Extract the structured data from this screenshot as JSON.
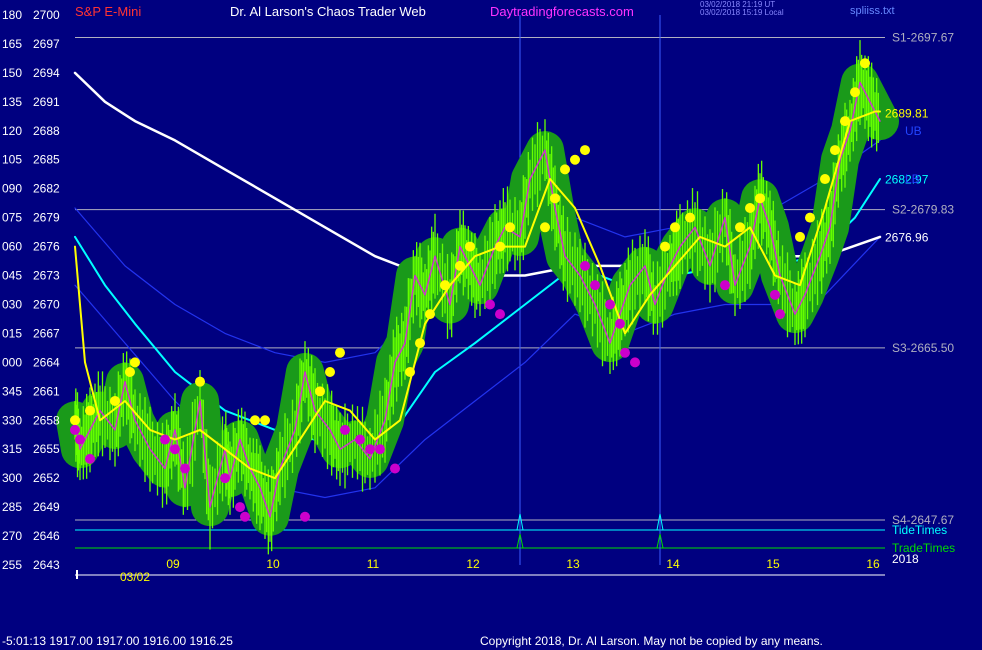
{
  "header": {
    "symbol": "S&P E-Mini",
    "title": "Dr. Al Larson's Chaos Trader Web",
    "site": "Daytradingforecasts.com",
    "timestamp_ut": "03/02/2018 21:19 UT",
    "timestamp_local": "03/02/2018 15:19 Local",
    "file": "spliiss.txt"
  },
  "footer": {
    "quote_line": "-5:01:13  1917.00 1917.00 1916.00 1916.25",
    "copyright": "Copyright 2018, Dr. Al Larson. May not be copied by any means."
  },
  "colors": {
    "background": "#000080",
    "grid": "#b0b0c0",
    "price_halo": "#1a9a1a",
    "price_bars": "#66ff00",
    "fast_avg": "#ffff00",
    "mid_avg": "#00ffff",
    "slow_avg": "#ffffff",
    "envelope": "#2233ee",
    "high_markers": "#ffff00",
    "low_markers": "#cc00cc",
    "tide_times": "#00ffff",
    "trade_times": "#00dd00"
  },
  "chart_data": {
    "type": "line",
    "y_axis": {
      "min": 2643,
      "max": 2700,
      "ticks": [
        {
          "value": 2700,
          "label": "2700",
          "left": "180"
        },
        {
          "value": 2697,
          "label": "2697",
          "left": "165"
        },
        {
          "value": 2694,
          "label": "2694",
          "left": "150"
        },
        {
          "value": 2691,
          "label": "2691",
          "left": "135"
        },
        {
          "value": 2688,
          "label": "2688",
          "left": "120"
        },
        {
          "value": 2685,
          "label": "2685",
          "left": "105"
        },
        {
          "value": 2682,
          "label": "2682",
          "left": "090"
        },
        {
          "value": 2679,
          "label": "2679",
          "left": "075"
        },
        {
          "value": 2676,
          "label": "2676",
          "left": "060"
        },
        {
          "value": 2673,
          "label": "2673",
          "left": "045"
        },
        {
          "value": 2670,
          "label": "2670",
          "left": "030"
        },
        {
          "value": 2667,
          "label": "2667",
          "left": "015"
        },
        {
          "value": 2664,
          "label": "2664",
          "left": "000"
        },
        {
          "value": 2661,
          "label": "2661",
          "left": "345"
        },
        {
          "value": 2658,
          "label": "2658",
          "left": "330"
        },
        {
          "value": 2655,
          "label": "2655",
          "left": "315"
        },
        {
          "value": 2652,
          "label": "2652",
          "left": "300"
        },
        {
          "value": 2649,
          "label": "2649",
          "left": "285"
        },
        {
          "value": 2646,
          "label": "2646",
          "left": "270"
        },
        {
          "value": 2643,
          "label": "2643",
          "left": "255"
        }
      ]
    },
    "x_axis": {
      "min": 8.0,
      "max": 16.1,
      "ticks": [
        "09",
        "10",
        "11",
        "12",
        "13",
        "14",
        "15",
        "16"
      ],
      "date_label": "03/02",
      "year_label": "2018"
    },
    "levels": [
      {
        "name": "S1",
        "value": 2697.67,
        "label": "S1-2697.67"
      },
      {
        "name": "S2",
        "value": 2679.83,
        "label": "S2-2679.83"
      },
      {
        "name": "S3",
        "value": 2665.5,
        "label": "S3-2665.50"
      },
      {
        "name": "S4",
        "value": 2647.67,
        "label": "S4-2647.67"
      }
    ],
    "band_labels": [
      "UB",
      "LB"
    ],
    "end_values": [
      {
        "value": 2689.81,
        "label": "2689.81",
        "series": "fast_avg"
      },
      {
        "value": 2682.97,
        "label": "2682.97",
        "series": "mid_avg"
      },
      {
        "value": 2676.96,
        "label": "2676.96",
        "series": "slow_avg"
      }
    ],
    "timing_lines": {
      "tide_label": "TideTimes",
      "trade_label": "TradeTimes",
      "spike_times": [
        12.45,
        13.85
      ]
    },
    "price": {
      "x": [
        8.0,
        8.05,
        8.15,
        8.25,
        8.4,
        8.5,
        8.6,
        8.75,
        8.9,
        9.0,
        9.1,
        9.25,
        9.35,
        9.5,
        9.55,
        9.65,
        9.75,
        9.85,
        9.95,
        10.05,
        10.2,
        10.3,
        10.4,
        10.55,
        10.65,
        10.8,
        10.95,
        11.1,
        11.2,
        11.3,
        11.4,
        11.5,
        11.6,
        11.75,
        11.85,
        11.95,
        12.05,
        12.2,
        12.3,
        12.45,
        12.55,
        12.7,
        12.8,
        12.9,
        13.05,
        13.2,
        13.35,
        13.45,
        13.55,
        13.7,
        13.8,
        13.95,
        14.05,
        14.2,
        14.35,
        14.5,
        14.6,
        14.75,
        14.85,
        14.95,
        15.05,
        15.2,
        15.3,
        15.45,
        15.55,
        15.65,
        15.75,
        15.85,
        15.95,
        16.05
      ],
      "y": [
        2658,
        2655,
        2657,
        2659,
        2657,
        2662,
        2658,
        2655,
        2653,
        2657,
        2651,
        2660,
        2649,
        2655,
        2652,
        2656,
        2653,
        2651,
        2648,
        2653,
        2657,
        2663,
        2659,
        2657,
        2655,
        2656,
        2654,
        2658,
        2664,
        2666,
        2673,
        2671,
        2675,
        2670,
        2676,
        2674,
        2672,
        2676,
        2678,
        2677,
        2683,
        2686,
        2680,
        2675,
        2673,
        2670,
        2666,
        2669,
        2672,
        2674,
        2670,
        2674,
        2676,
        2678,
        2674,
        2679,
        2672,
        2676,
        2681,
        2678,
        2673,
        2669,
        2671,
        2675,
        2678,
        2685,
        2688,
        2693,
        2691,
        2689
      ]
    },
    "series": [
      {
        "name": "fast_avg",
        "x": [
          8.0,
          8.1,
          8.25,
          8.5,
          8.75,
          9.0,
          9.25,
          9.5,
          9.75,
          10.0,
          10.25,
          10.5,
          10.75,
          11.0,
          11.25,
          11.5,
          11.75,
          12.0,
          12.25,
          12.5,
          12.75,
          13.0,
          13.25,
          13.5,
          13.75,
          14.0,
          14.25,
          14.5,
          14.75,
          15.0,
          15.25,
          15.5,
          15.75,
          16.0,
          16.05
        ],
        "y": [
          2676,
          2664,
          2658,
          2660,
          2657,
          2656,
          2657,
          2655,
          2653,
          2652,
          2656,
          2660,
          2659,
          2656,
          2658,
          2668,
          2672,
          2675,
          2676,
          2676,
          2683,
          2680,
          2674,
          2667,
          2671,
          2674,
          2677,
          2676,
          2678,
          2673,
          2672,
          2680,
          2689,
          2690,
          2690
        ]
      },
      {
        "name": "mid_avg",
        "x": [
          8.0,
          8.3,
          8.6,
          9.0,
          9.5,
          10.0,
          10.4,
          10.8,
          11.2,
          11.6,
          12.0,
          12.5,
          13.0,
          13.5,
          14.0,
          14.5,
          15.0,
          15.4,
          15.8,
          16.05
        ],
        "y": [
          2677,
          2672,
          2668,
          2663,
          2659,
          2657,
          2656,
          2657,
          2657,
          2663,
          2666,
          2670,
          2674,
          2672,
          2673,
          2674,
          2674,
          2675,
          2679,
          2683
        ]
      },
      {
        "name": "slow_avg",
        "x": [
          8.0,
          8.3,
          8.6,
          9.0,
          9.5,
          10.0,
          10.5,
          11.0,
          11.5,
          12.0,
          12.5,
          13.0,
          13.5,
          14.0,
          14.5,
          15.0,
          15.5,
          16.05
        ],
        "y": [
          2694,
          2691,
          2689,
          2687,
          2684,
          2681,
          2678,
          2675,
          2673,
          2673,
          2673,
          2674,
          2674,
          2674,
          2674,
          2675,
          2675,
          2677
        ]
      },
      {
        "name": "upper_band",
        "x": [
          8.0,
          8.5,
          9.0,
          9.5,
          10.0,
          10.5,
          11.0,
          11.5,
          12.0,
          12.5,
          13.0,
          13.5,
          14.0,
          14.5,
          15.0,
          15.5,
          16.05
        ],
        "y": [
          2680,
          2674,
          2670,
          2667,
          2665,
          2664,
          2665,
          2670,
          2673,
          2677,
          2679,
          2677,
          2678,
          2679,
          2680,
          2683,
          2687
        ]
      },
      {
        "name": "lower_band",
        "x": [
          8.0,
          8.5,
          9.0,
          9.5,
          10.0,
          10.5,
          11.0,
          11.5,
          12.0,
          12.5,
          13.0,
          13.5,
          14.0,
          14.5,
          15.0,
          15.5,
          16.05
        ],
        "y": [
          2672,
          2666,
          2660,
          2655,
          2651,
          2650,
          2651,
          2656,
          2660,
          2664,
          2669,
          2667,
          2669,
          2670,
          2670,
          2671,
          2677
        ]
      }
    ],
    "high_markers": {
      "x": [
        8.0,
        8.15,
        8.4,
        8.55,
        8.6,
        9.25,
        9.8,
        9.9,
        10.45,
        10.55,
        10.65,
        11.35,
        11.45,
        11.55,
        11.7,
        11.85,
        11.95,
        12.25,
        12.35,
        12.7,
        12.8,
        12.9,
        13.0,
        13.1,
        13.9,
        14.0,
        14.15,
        14.65,
        14.75,
        14.85,
        15.25,
        15.35,
        15.5,
        15.6,
        15.7,
        15.8,
        15.9
      ],
      "y": [
        2658,
        2659,
        2660,
        2663,
        2664,
        2662,
        2658,
        2658,
        2661,
        2663,
        2665,
        2663,
        2666,
        2669,
        2672,
        2674,
        2676,
        2676,
        2678,
        2678,
        2681,
        2684,
        2685,
        2686,
        2676,
        2678,
        2679,
        2678,
        2680,
        2681,
        2677,
        2679,
        2683,
        2686,
        2689,
        2692,
        2695
      ]
    },
    "low_markers": {
      "x": [
        8.0,
        8.05,
        8.15,
        8.9,
        9.0,
        9.1,
        9.5,
        9.65,
        9.7,
        10.3,
        10.7,
        10.85,
        10.95,
        11.05,
        11.2,
        12.15,
        12.25,
        13.1,
        13.2,
        13.35,
        13.45,
        13.5,
        13.6,
        14.5,
        15.0,
        15.05
      ],
      "y": [
        2657,
        2656,
        2654,
        2656,
        2655,
        2653,
        2652,
        2649,
        2648,
        2648,
        2657,
        2656,
        2655,
        2655,
        2653,
        2670,
        2669,
        2674,
        2672,
        2670,
        2668,
        2665,
        2664,
        2672,
        2671,
        2669
      ]
    }
  }
}
